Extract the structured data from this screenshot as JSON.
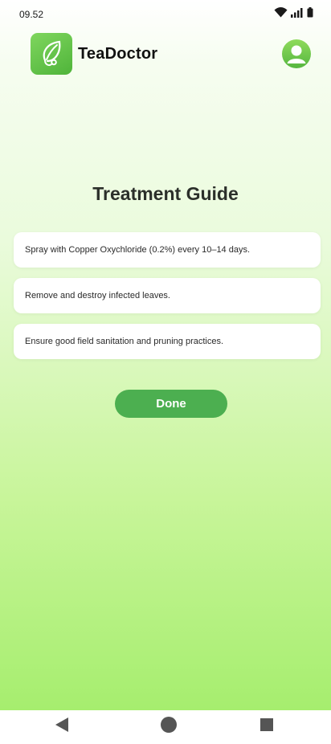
{
  "status_bar": {
    "time": "09.52",
    "icons": [
      "wifi-icon",
      "signal-icon",
      "battery-icon"
    ]
  },
  "app": {
    "name": "TeaDoctor",
    "logo_icon": "leaf-stethoscope-icon",
    "profile_icon": "user-icon"
  },
  "page": {
    "title": "Treatment Guide"
  },
  "steps": [
    "Spray with Copper Oxychloride (0.2%) every 10–14 days.",
    "Remove and destroy infected leaves.",
    "Ensure good field sanitation and pruning practices."
  ],
  "actions": {
    "done_label": "Done"
  },
  "nav_bar": {
    "icons": [
      "back-icon",
      "home-icon",
      "recents-icon"
    ]
  },
  "colors": {
    "accent": "#4caf50",
    "logo": "#5fc447",
    "background_top": "#ffffff",
    "background_bottom": "#a6ee6e"
  }
}
